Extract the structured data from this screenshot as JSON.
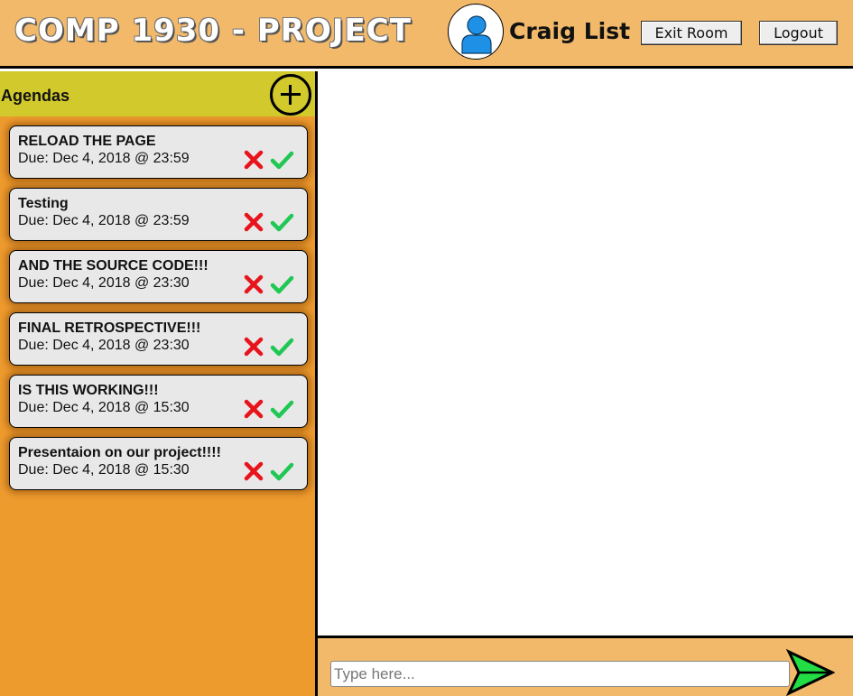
{
  "header": {
    "title": "COMP 1930 - PROJECT",
    "username": "Craig List",
    "exit_room_label": "Exit Room",
    "logout_label": "Logout"
  },
  "sidebar": {
    "heading": "Agendas",
    "add_icon": "plus-circle-icon",
    "agendas": [
      {
        "title": "RELOAD THE PAGE",
        "due": "Due: Dec 4, 2018 @ 23:59"
      },
      {
        "title": "Testing",
        "due": "Due: Dec 4, 2018 @ 23:59"
      },
      {
        "title": "AND THE SOURCE CODE!!!",
        "due": "Due: Dec 4, 2018 @ 23:30"
      },
      {
        "title": "FINAL RETROSPECTIVE!!!",
        "due": "Due: Dec 4, 2018 @ 23:30"
      },
      {
        "title": "IS THIS WORKING!!!",
        "due": "Due: Dec 4, 2018 @ 15:30"
      },
      {
        "title": "Presentaion on our project!!!!",
        "due": "Due: Dec 4, 2018 @ 15:30"
      }
    ]
  },
  "chat": {
    "input_placeholder": "Type here...",
    "send_icon": "send-arrow-icon"
  },
  "colors": {
    "header_bg": "#f2b96a",
    "sidebar_bg": "#ee9b2e",
    "agenda_header_bg": "#d2c92c",
    "delete_red": "#e8141c",
    "complete_green": "#1fc753",
    "send_green": "#22dd44",
    "avatar_blue": "#1e90e6"
  }
}
